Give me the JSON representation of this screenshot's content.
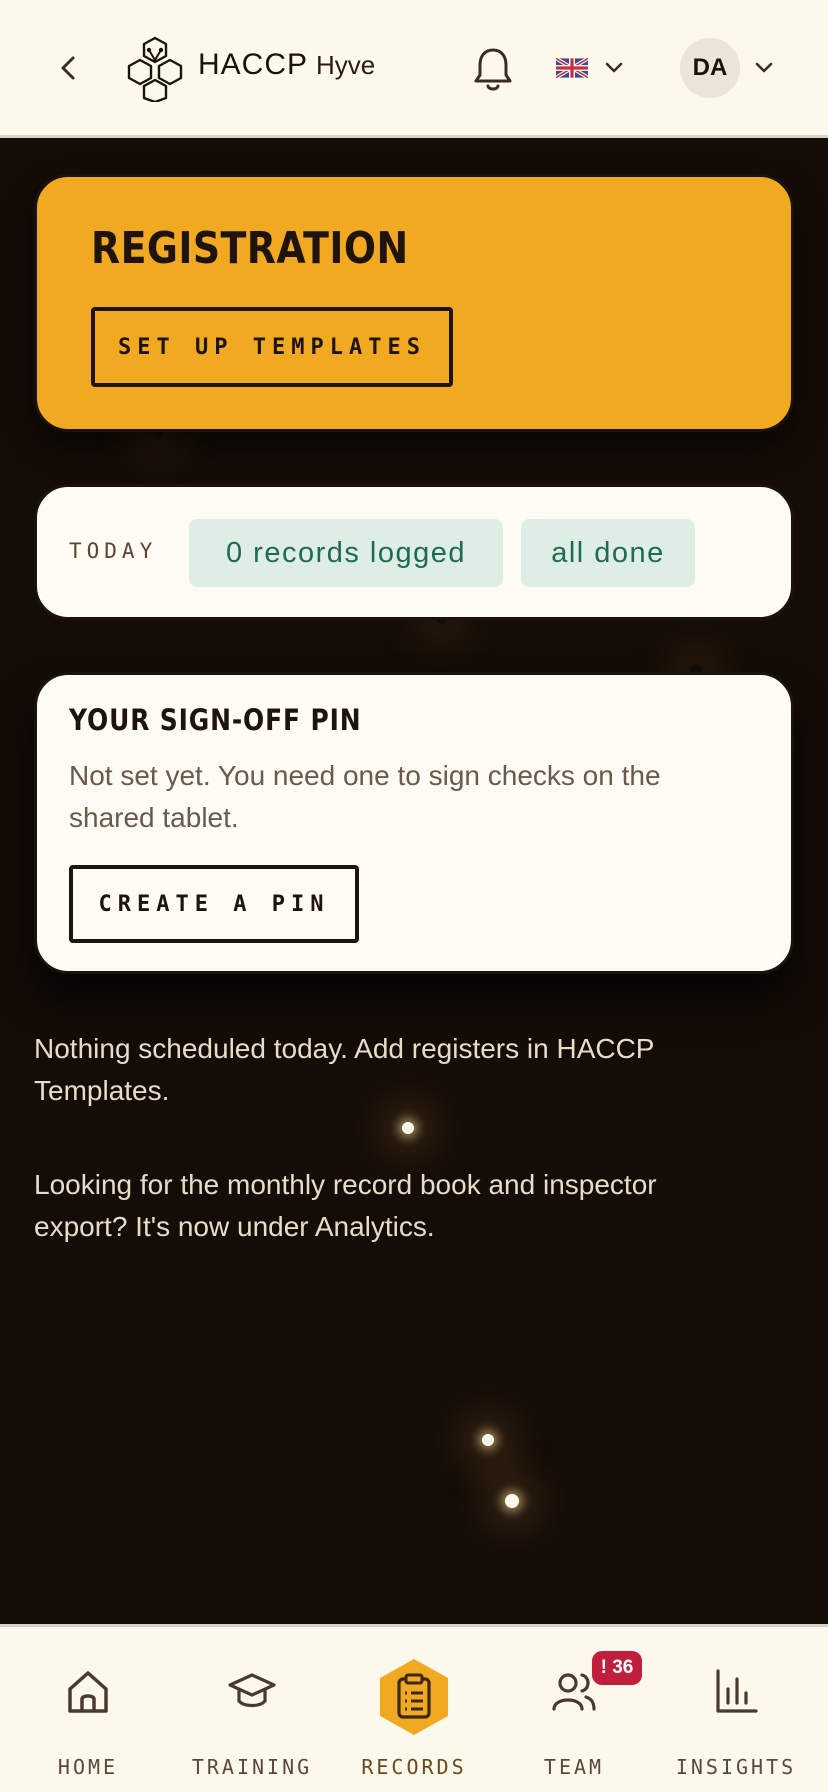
{
  "header": {
    "brand_main": "HACCP",
    "brand_sub": "Hyve",
    "avatar_initials": "DA",
    "icons": {
      "back": "chevron-left-icon",
      "notifications": "bell-icon",
      "language": "uk-flag-icon",
      "dropdown": "chevron-down-icon"
    }
  },
  "registration": {
    "title": "REGISTRATION",
    "button": "SET UP TEMPLATES"
  },
  "today": {
    "label": "TODAY",
    "records_chip": "0 records logged",
    "status_chip": "all done"
  },
  "pin": {
    "title": "YOUR SIGN-OFF PIN",
    "description": "Not set yet. You need one to sign checks on the shared tablet.",
    "button": "CREATE A PIN"
  },
  "messages": {
    "schedule": "Nothing scheduled today. Add registers in HACCP Templates.",
    "analytics": "Looking for the monthly record book and inspector export? It's now under Analytics."
  },
  "nav": {
    "items": [
      {
        "label": "HOME",
        "icon": "home-icon"
      },
      {
        "label": "TRAINING",
        "icon": "graduation-cap-icon"
      },
      {
        "label": "RECORDS",
        "icon": "clipboard-icon",
        "active": true
      },
      {
        "label": "TEAM",
        "icon": "users-icon",
        "badge": "! 36"
      },
      {
        "label": "INSIGHTS",
        "icon": "bar-chart-icon"
      }
    ]
  },
  "colors": {
    "accent": "#f1a922",
    "background": "#140c07",
    "card": "#fdfbf4",
    "chip_bg": "#dfeee4",
    "chip_text": "#1e6a55",
    "badge": "#c0203c"
  }
}
